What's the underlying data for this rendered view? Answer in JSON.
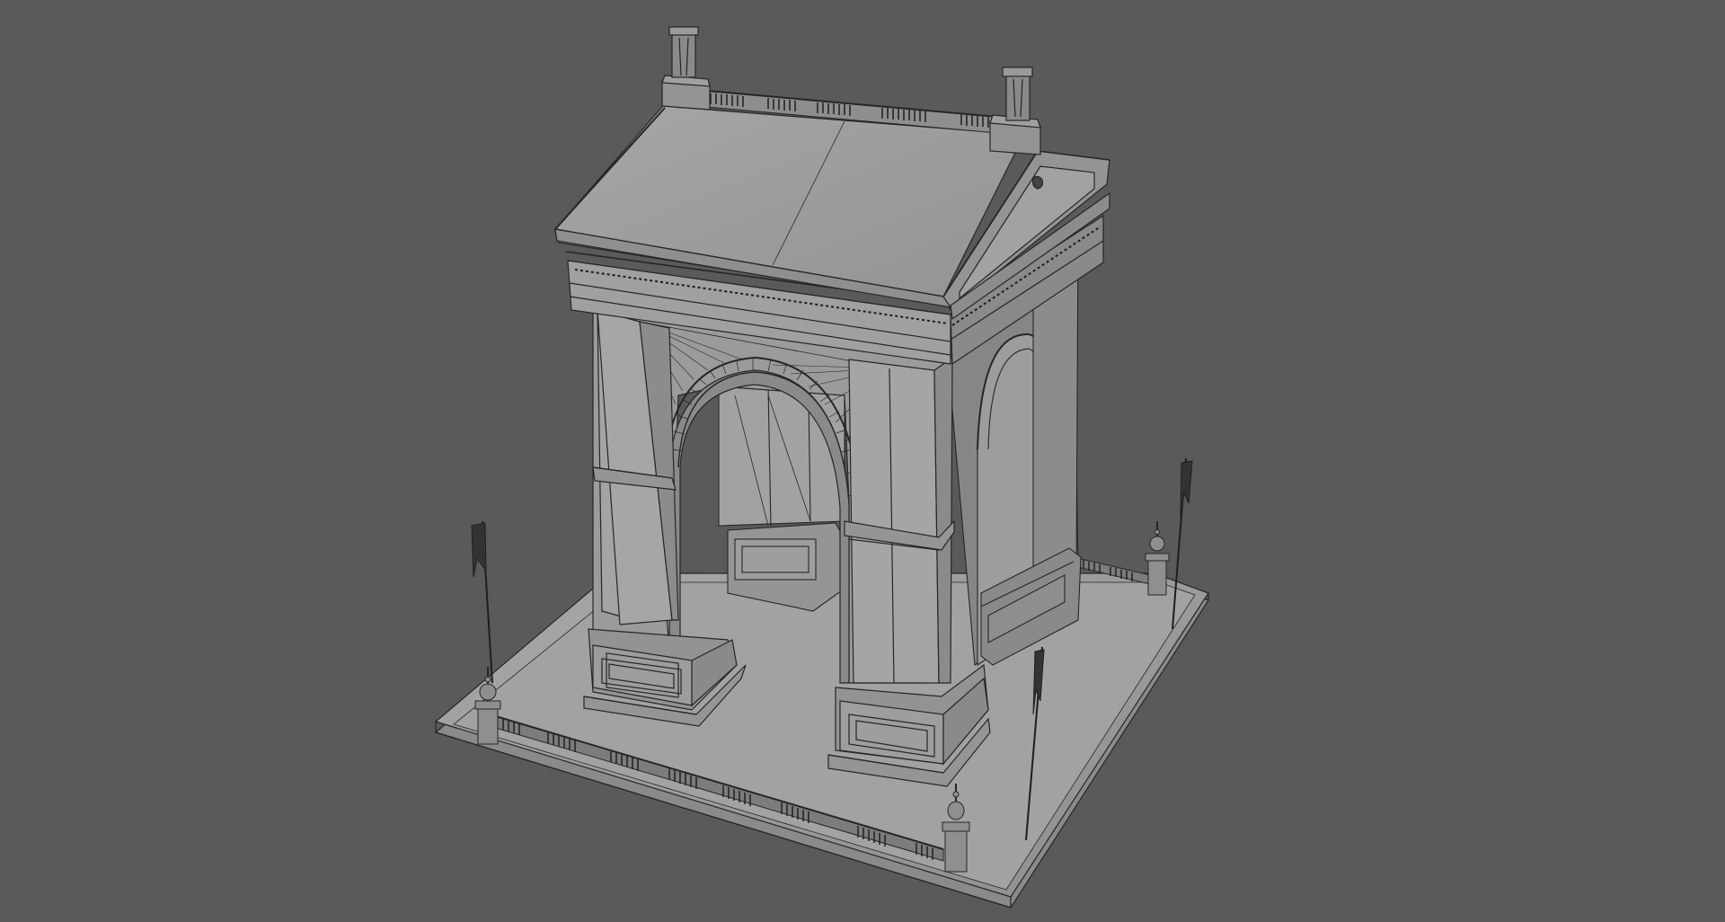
{
  "viewport": {
    "background": "#5a5a5a",
    "model_fill": "#9a9a9a",
    "model_shade": "#858585",
    "model_dark": "#707070",
    "wire_color": "#262626"
  }
}
